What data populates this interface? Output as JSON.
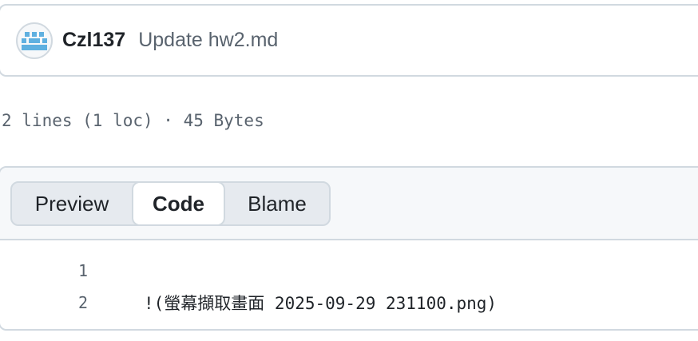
{
  "commit": {
    "author": "Czl137",
    "message": "Update hw2.md"
  },
  "file_info": {
    "summary": "2 lines (1 loc) · 45 Bytes"
  },
  "view_tabs": {
    "preview": "Preview",
    "code": "Code",
    "blame": "Blame",
    "selected": "Code"
  },
  "code": {
    "lines": [
      {
        "number": "1",
        "text": ""
      },
      {
        "number": "2",
        "text": "!(螢幕擷取畫面 2025-09-29 231100.png)"
      }
    ]
  },
  "colors": {
    "border": "#d1d9e0",
    "muted_text": "#59636e",
    "header_bg": "#f6f8fa",
    "avatar_accent": "#5fb0e0"
  }
}
